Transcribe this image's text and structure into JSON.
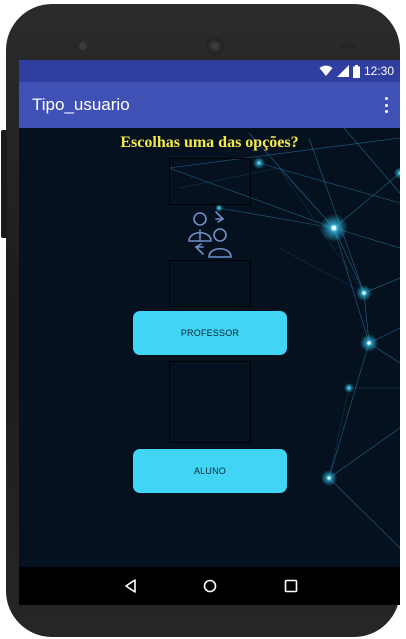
{
  "status_bar": {
    "time": "12:30"
  },
  "app_bar": {
    "title": "Tipo_usuario"
  },
  "screen": {
    "prompt": "Escolhas uma das opções?",
    "professor_button": "PROFESSOR",
    "aluno_button": "ALUNO"
  },
  "icons": {
    "wifi": "wifi-icon",
    "signal": "signal-icon",
    "battery": "battery-icon",
    "overflow": "more-vert-icon",
    "switch_user": "switch-user-icon",
    "back": "back-icon",
    "home": "home-icon",
    "recents": "recents-icon"
  },
  "colors": {
    "status_bar": "#303f9f",
    "app_bar": "#3f51b5",
    "button": "#40d5f5",
    "prompt_text": "#f5e94a",
    "background": "#06111f"
  }
}
